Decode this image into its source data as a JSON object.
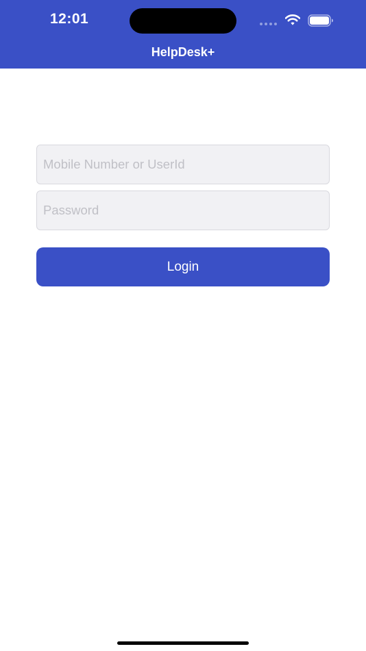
{
  "status_bar": {
    "time": "12:01",
    "icons": [
      "signal-dots-icon",
      "wifi-icon",
      "battery-icon"
    ]
  },
  "nav": {
    "title": "HelpDesk+"
  },
  "login_form": {
    "user_field": {
      "placeholder": "Mobile Number or UserId",
      "value": ""
    },
    "password_field": {
      "placeholder": "Password",
      "value": ""
    },
    "login_label": "Login"
  },
  "colors": {
    "brand": "#3A50C6",
    "field_background": "#F1F1F4",
    "placeholder": "#C0C0C6"
  }
}
